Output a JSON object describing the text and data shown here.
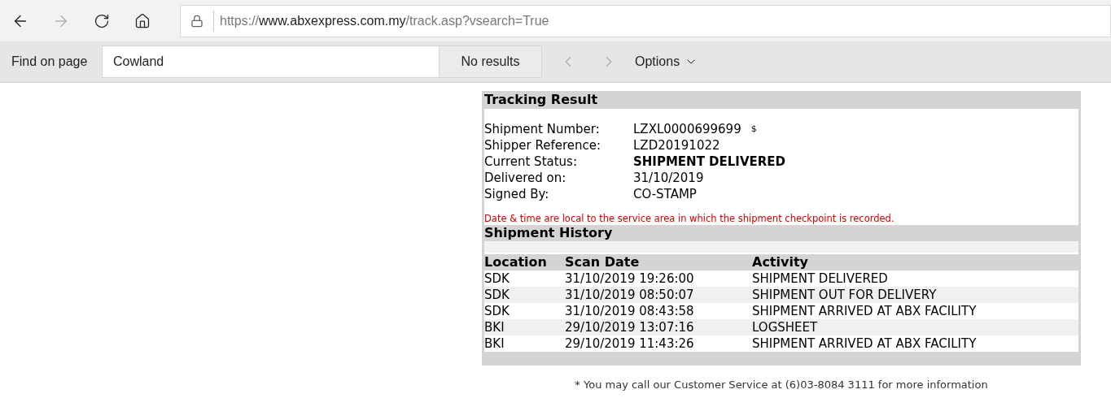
{
  "nav": {
    "back": {
      "disabled": false
    },
    "forward": {
      "disabled": true
    }
  },
  "address": {
    "scheme": "https://",
    "host": "www.abxexpress.com.my",
    "path": "/track.asp?vsearch=True"
  },
  "find_bar": {
    "label": "Find on page",
    "value": "Cowland",
    "result": "No results",
    "previous": {
      "disabled": true
    },
    "next": {
      "disabled": true
    },
    "options": "Options"
  },
  "tracking": {
    "title": "Tracking Result",
    "fields": [
      {
        "label": "Shipment Number:",
        "value": "LZXL0000699699",
        "suffix": "$",
        "bold": false
      },
      {
        "label": "Shipper Reference:",
        "value": "LZD20191022",
        "bold": false
      },
      {
        "label": "Current Status:",
        "value": "SHIPMENT DELIVERED",
        "bold": true
      },
      {
        "label": "Delivered on:",
        "value": "31/10/2019",
        "bold": false
      },
      {
        "label": "Signed By:",
        "value": "CO-STAMP",
        "bold": false
      }
    ],
    "note": "Date & time are local to the service area in which the shipment checkpoint is recorded."
  },
  "history": {
    "title": "Shipment History",
    "columns": [
      "Location",
      "Scan Date",
      "Activity"
    ],
    "rows": [
      [
        "SDK",
        "31/10/2019 19:26:00",
        "SHIPMENT DELIVERED"
      ],
      [
        "SDK",
        "31/10/2019 08:50:07",
        "SHIPMENT OUT FOR DELIVERY"
      ],
      [
        "SDK",
        "31/10/2019 08:43:58",
        "SHIPMENT ARRIVED AT ABX FACILITY"
      ],
      [
        "BKI",
        "29/10/2019 13:07:16",
        "LOGSHEET"
      ],
      [
        "BKI",
        "29/10/2019 11:43:26",
        "SHIPMENT ARRIVED AT ABX FACILITY"
      ]
    ]
  },
  "footer": "* You may call our Customer Service at (6)03-8084 3111 for more information"
}
